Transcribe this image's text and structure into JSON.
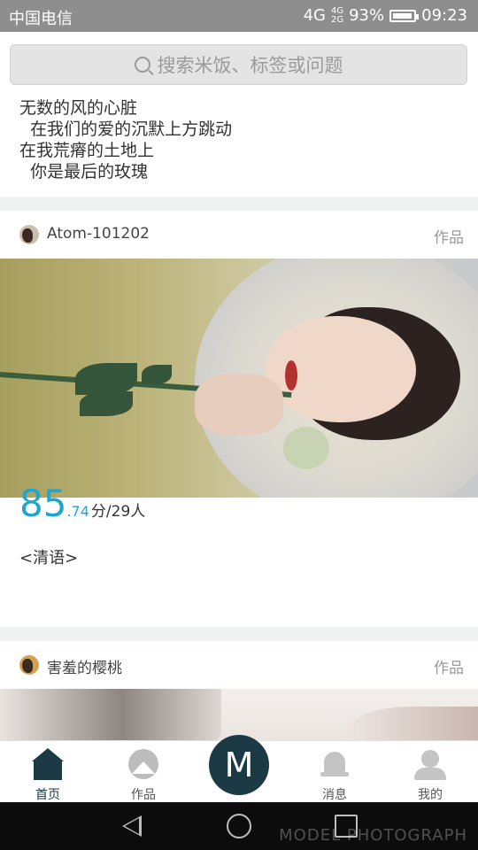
{
  "status_bar": {
    "carrier": "中国电信",
    "network_top": "4G",
    "network_mini_top": "4G",
    "network_mini_bottom": "2G",
    "battery_percent_text": "93%",
    "battery_level": 0.93,
    "time": "09:23"
  },
  "search": {
    "placeholder": "搜索米饭、标签或问题",
    "icon": "search-icon"
  },
  "poem": {
    "lines": [
      "无数的风的心脏",
      "  在我们的爱的沉默上方跳动",
      "在我荒瘠的土地上",
      "  你是最后的玫瑰"
    ]
  },
  "feed": [
    {
      "username": "Atom-101202",
      "tag": "作品",
      "score_int": "85",
      "score_dec": ".74",
      "score_rest": "分/29人",
      "caption": "<清语>"
    },
    {
      "username": "害羞的樱桃",
      "tag": "作品"
    }
  ],
  "tabbar": {
    "tabs": [
      {
        "label": "首页",
        "icon": "home-icon"
      },
      {
        "label": "作品",
        "icon": "gallery-icon"
      },
      {
        "label": "M",
        "icon": "center-m-button"
      },
      {
        "label": "消息",
        "icon": "bell-icon"
      },
      {
        "label": "我的",
        "icon": "person-icon"
      }
    ],
    "accent": "#1b3a45"
  },
  "watermark": "MODEL PHOTOGRAPH",
  "colors": {
    "score": "#1ea6cf",
    "accent": "#1b3a45"
  }
}
